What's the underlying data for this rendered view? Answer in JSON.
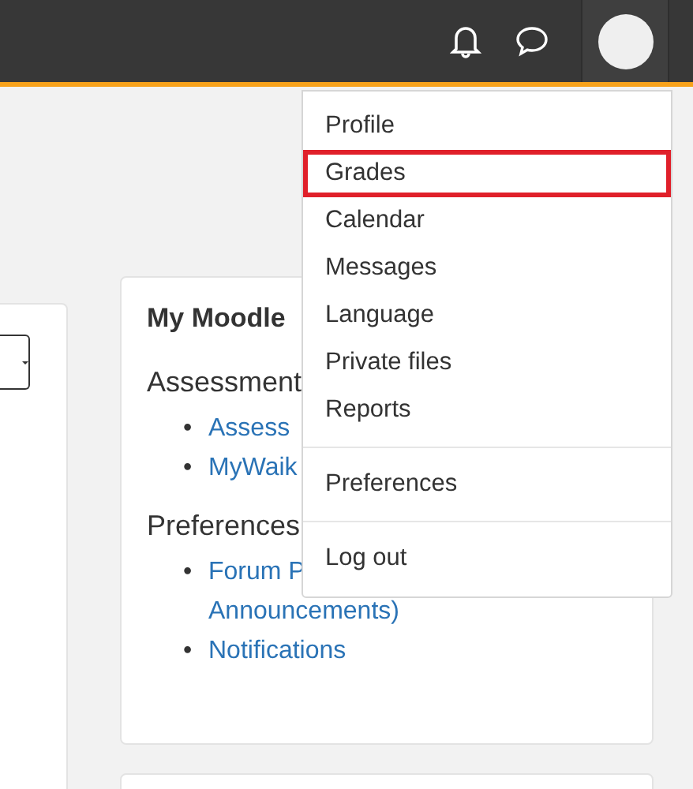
{
  "card": {
    "title": "My Moodle",
    "sections": [
      {
        "heading": "Assessment",
        "links": [
          {
            "bullet": "•",
            "text": "Assess"
          },
          {
            "bullet": "•",
            "text": "MyWaik"
          }
        ]
      },
      {
        "heading": "Preferences",
        "links": [
          {
            "bullet": "•",
            "text": "Forum P"
          },
          {
            "text": "Announcements)"
          },
          {
            "bullet": "•",
            "text": "Notifications"
          }
        ]
      }
    ]
  },
  "user_menu": {
    "groups": [
      [
        {
          "label": "Profile",
          "highlighted": false
        },
        {
          "label": "Grades",
          "highlighted": true
        },
        {
          "label": "Calendar",
          "highlighted": false
        },
        {
          "label": "Messages",
          "highlighted": false
        },
        {
          "label": "Language",
          "highlighted": false
        },
        {
          "label": "Private files",
          "highlighted": false
        },
        {
          "label": "Reports",
          "highlighted": false
        }
      ],
      [
        {
          "label": "Preferences",
          "highlighted": false
        }
      ],
      [
        {
          "label": "Log out",
          "highlighted": false
        }
      ]
    ]
  }
}
